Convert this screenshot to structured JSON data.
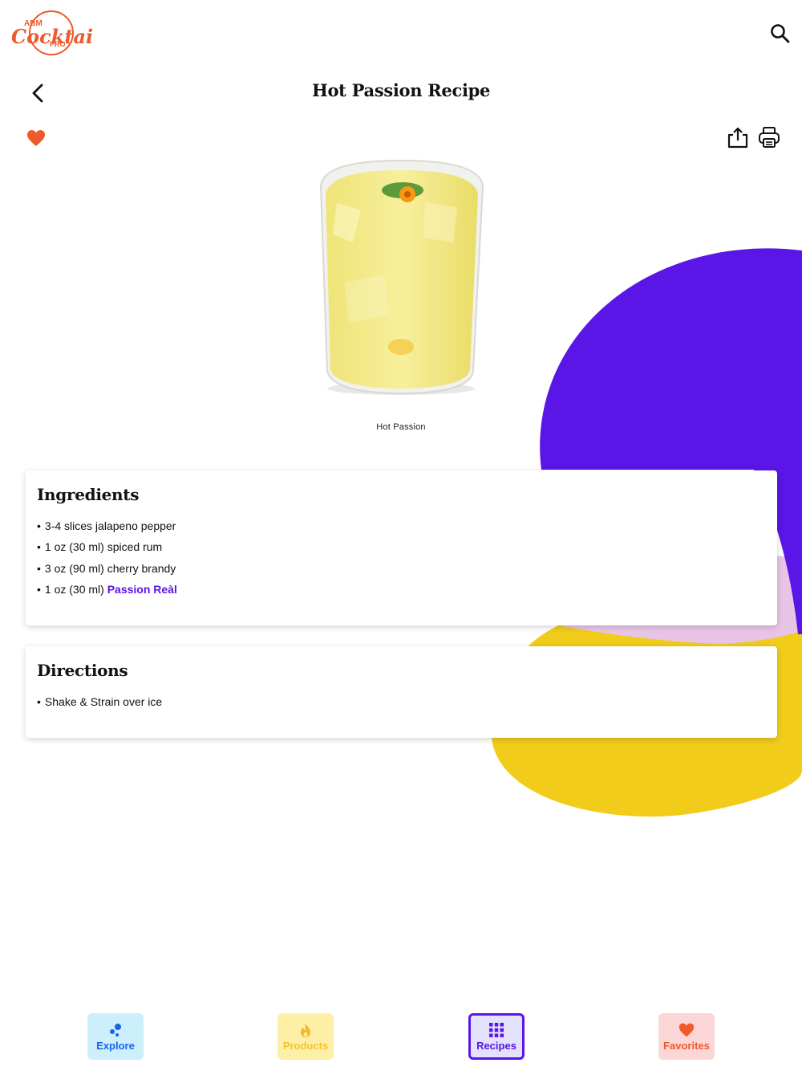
{
  "app": {
    "logo_text_top": "ABM",
    "logo_text_main": "Cocktail",
    "logo_text_bottom": "PRO"
  },
  "header": {
    "title": "Hot Passion Recipe"
  },
  "drink": {
    "caption": "Hot Passion"
  },
  "ingredients": {
    "heading": "Ingredients",
    "items": [
      {
        "bullet": "•",
        "text": "3-4 slices jalapeno pepper"
      },
      {
        "bullet": "•",
        "text": "1 oz (30 ml) spiced rum"
      },
      {
        "bullet": "•",
        "text": "3 oz (90 ml) cherry brandy"
      },
      {
        "bullet": "•",
        "text": "1 oz (30 ml)",
        "link": "Passion Reàl"
      }
    ]
  },
  "directions": {
    "heading": "Directions",
    "items": [
      {
        "bullet": "•",
        "text": "Shake & Strain over ice"
      }
    ]
  },
  "nav": {
    "explore": "Explore",
    "products": "Products",
    "recipes": "Recipes",
    "favorites": "Favorites",
    "active": "recipes"
  },
  "colors": {
    "brand_orange": "#ee5a2c",
    "purple": "#5a16e6",
    "yellow": "#f2cc1a",
    "pink": "#e8c4e6"
  }
}
